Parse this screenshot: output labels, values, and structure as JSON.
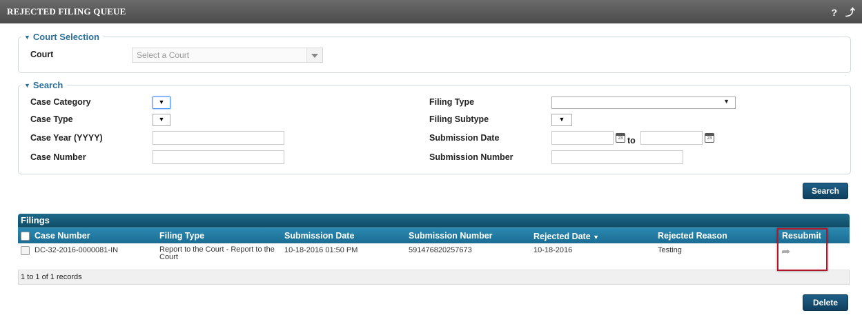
{
  "titlebar": {
    "title": "REJECTED FILING QUEUE",
    "help_icon": "?",
    "popout_icon": "⤴"
  },
  "court_selection": {
    "legend": "Court Selection",
    "court_label": "Court",
    "court_placeholder": "Select a Court"
  },
  "search": {
    "legend": "Search",
    "case_category_label": "Case Category",
    "case_type_label": "Case Type",
    "case_year_label": "Case Year (YYYY)",
    "case_number_label": "Case Number",
    "filing_type_label": "Filing Type",
    "filing_subtype_label": "Filing Subtype",
    "submission_date_label": "Submission Date",
    "date_to_label": "to",
    "submission_number_label": "Submission Number",
    "dropdown_glyph": "▼",
    "search_button": "Search"
  },
  "filings": {
    "title": "Filings",
    "headers": [
      "Case Number",
      "Filing Type",
      "Submission Date",
      "Submission Number",
      "Rejected Date",
      "Rejected Reason",
      "Resubmit"
    ],
    "sort_indicator": "▼",
    "rows": [
      {
        "case_number": "DC-32-2016-0000081-IN",
        "filing_type": "Report to the Court - Report to the Court",
        "submission_date": "10-18-2016 01:50 PM",
        "submission_number": "591476820257673",
        "rejected_date": "10-18-2016",
        "rejected_reason": "Testing",
        "resubmit_icon": "share-arrow-icon"
      }
    ],
    "footer": "1 to 1 of 1 records",
    "delete_button": "Delete"
  },
  "colors": {
    "accent": "#1a6d93",
    "highlight": "#b3172a",
    "titlebar": "#555555"
  }
}
